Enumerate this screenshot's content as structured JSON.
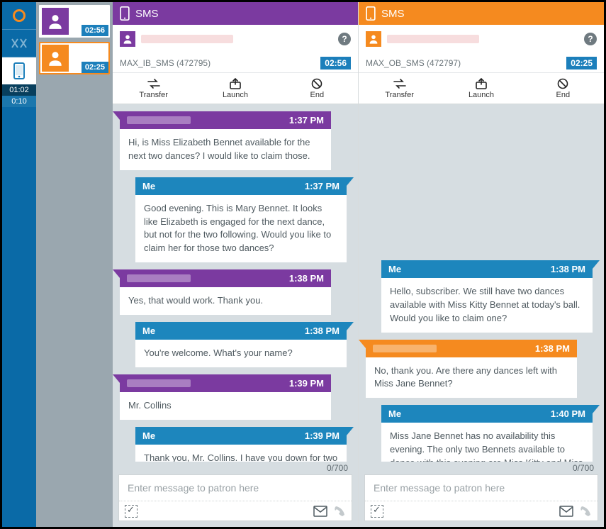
{
  "rail": {
    "time1": "01:02",
    "time2": "0:10"
  },
  "cards": [
    {
      "accent": "purple",
      "time": "02:56"
    },
    {
      "accent": "orange",
      "time": "02:25"
    }
  ],
  "panels": [
    {
      "accent": "purple",
      "title": "SMS",
      "skill": "MAX_IB_SMS (472795)",
      "elapsed": "02:56",
      "actions": {
        "transfer": "Transfer",
        "launch": "Launch",
        "end": "End"
      },
      "messages": [
        {
          "dir": "in",
          "time": "1:37 PM",
          "body": "Hi, is Miss Elizabeth Bennet available for the next two dances? I would like to claim those."
        },
        {
          "dir": "out",
          "who": "Me",
          "time": "1:37 PM",
          "body": "Good evening. This is Mary Bennet. It looks like Elizabeth is engaged for the next dance, but not for the two following. Would you like to claim her for those two dances?"
        },
        {
          "dir": "in",
          "time": "1:38 PM",
          "body": "Yes, that would work. Thank you."
        },
        {
          "dir": "out",
          "who": "Me",
          "time": "1:38 PM",
          "body": "You're welcome. What's your name?"
        },
        {
          "dir": "in",
          "time": "1:39 PM",
          "body": "Mr. Collins"
        },
        {
          "dir": "out",
          "who": "Me",
          "time": "1:39 PM",
          "body": "Thank you, Mr. Collins. I have you down for two dances with Miss Elizabeth Bennet."
        }
      ],
      "counter": "0/700",
      "placeholder": "Enter message to patron here"
    },
    {
      "accent": "orange",
      "title": "SMS",
      "skill": "MAX_OB_SMS (472797)",
      "elapsed": "02:25",
      "actions": {
        "transfer": "Transfer",
        "launch": "Launch",
        "end": "End"
      },
      "messages": [
        {
          "dir": "out",
          "who": "Me",
          "time": "1:38 PM",
          "body": "Hello, subscriber. We still have two dances available with Miss Kitty Bennet at today's ball. Would you like to claim one?"
        },
        {
          "dir": "in",
          "time": "1:38 PM",
          "body": "No, thank you. Are there any dances left with Miss Jane Bennet?"
        },
        {
          "dir": "out",
          "who": "Me",
          "time": "1:40 PM",
          "body": "Miss Jane Bennet has no availability this evening. The only two Bennets available to dance with this evening are Miss Kitty and Miss Lydia Bennet."
        }
      ],
      "counter": "0/700",
      "placeholder": "Enter message to patron here"
    }
  ]
}
